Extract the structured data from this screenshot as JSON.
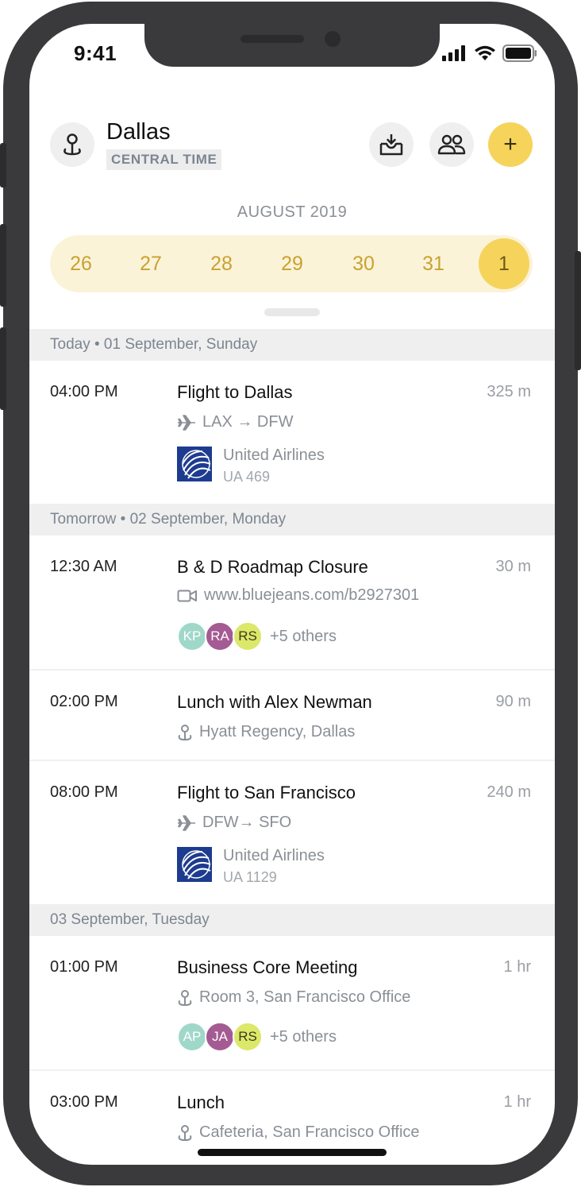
{
  "status": {
    "time": "9:41"
  },
  "header": {
    "city": "Dallas",
    "timezone": "CENTRAL TIME",
    "add_symbol": "+"
  },
  "calendar": {
    "month": "AUGUST 2019",
    "dates": [
      "26",
      "27",
      "28",
      "29",
      "30",
      "31",
      "1"
    ],
    "selected": "1"
  },
  "sections": [
    {
      "label": "Today • 01 September, Sunday"
    },
    {
      "label": "Tomorrow • 02 September, Monday"
    },
    {
      "label": "03 September, Tuesday"
    }
  ],
  "events": [
    {
      "time": "04:00 PM",
      "title": "Flight to Dallas",
      "duration": "325 m",
      "route": "LAX → DFW",
      "airline": "United Airlines",
      "flight": "UA 469"
    },
    {
      "time": "12:30 AM",
      "title": "B & D Roadmap Closure",
      "duration": "30 m",
      "link": "www.bluejeans.com/b2927301",
      "attendees": [
        "KP",
        "RA",
        "RS"
      ],
      "others": "+5 others"
    },
    {
      "time": "02:00 PM",
      "title": "Lunch with Alex Newman",
      "duration": "90 m",
      "location": "Hyatt Regency, Dallas"
    },
    {
      "time": "08:00 PM",
      "title": "Flight to San Francisco",
      "duration": "240 m",
      "route": "DFW→ SFO",
      "airline": "United Airlines",
      "flight": "UA 1129"
    },
    {
      "time": "01:00 PM",
      "title": "Business Core Meeting",
      "duration": "1 hr",
      "location": "Room 3, San Francisco Office",
      "attendees": [
        "AP",
        "JA",
        "RS"
      ],
      "others": "+5 others"
    },
    {
      "time": "03:00 PM",
      "title": "Lunch",
      "duration": "1 hr",
      "location": "Cafeteria, San Francisco Office"
    }
  ],
  "colors": {
    "accent": "#f6d35a",
    "date_strip": "#fbf3d8",
    "avatar_teal": "#9fd8c8",
    "avatar_purple": "#a45a92",
    "avatar_lime": "#dbe86a"
  }
}
